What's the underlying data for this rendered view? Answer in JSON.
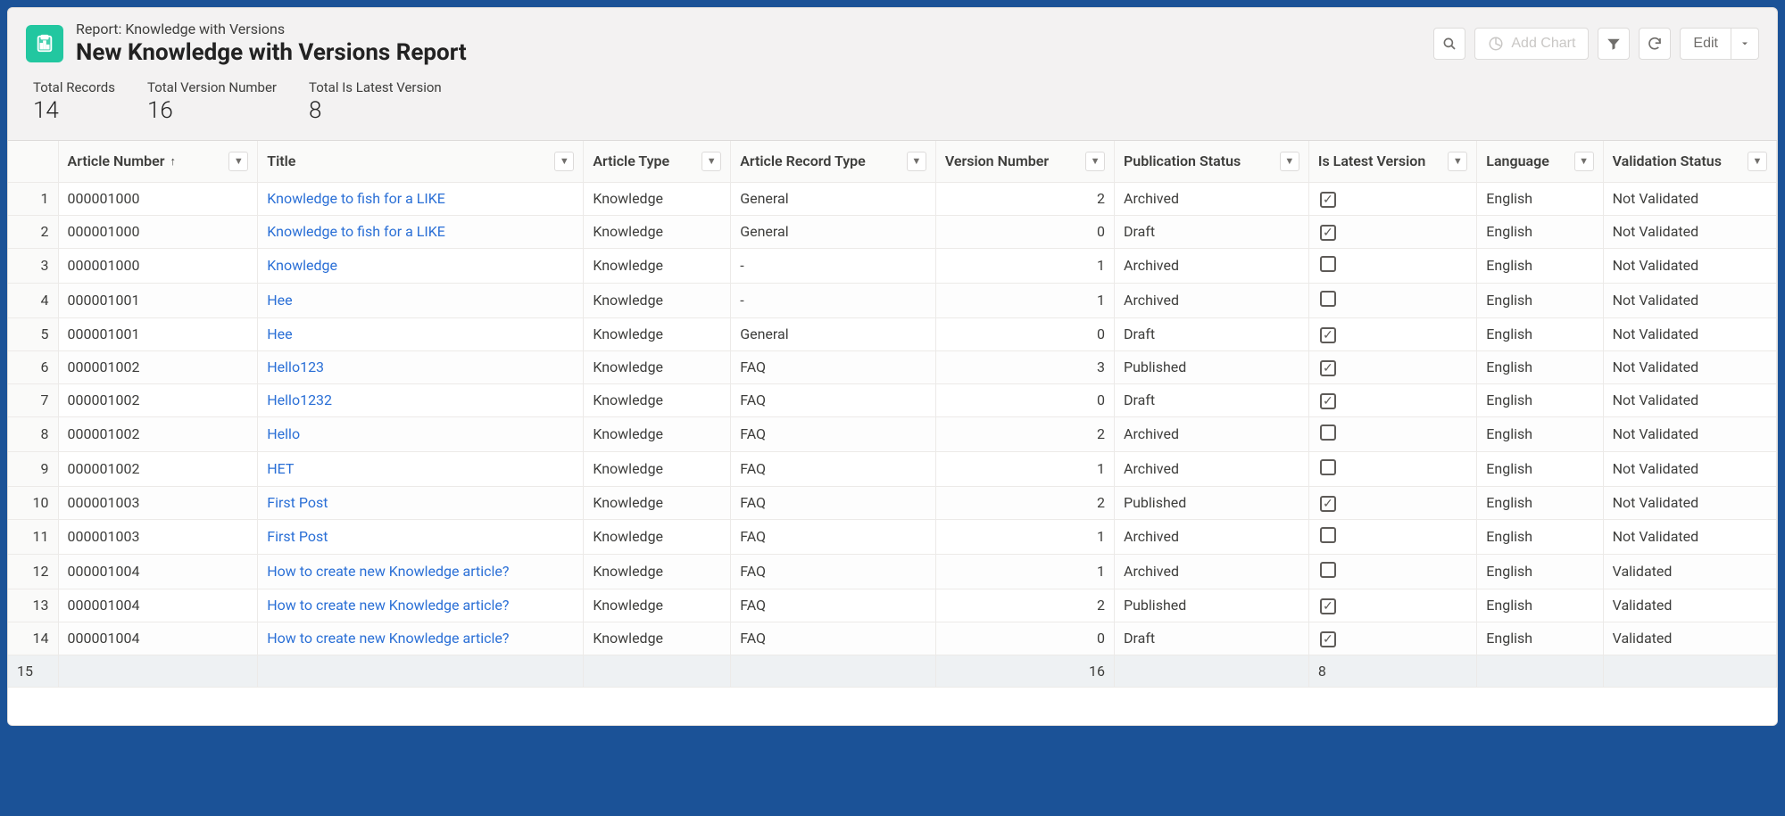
{
  "breadcrumb": "Report: Knowledge with Versions",
  "page_title": "New Knowledge with Versions Report",
  "actions": {
    "add_chart": "Add Chart",
    "edit": "Edit"
  },
  "summary": [
    {
      "label": "Total Records",
      "value": "14"
    },
    {
      "label": "Total Version Number",
      "value": "16"
    },
    {
      "label": "Total Is Latest Version",
      "value": "8"
    }
  ],
  "columns": [
    {
      "key": "article_number",
      "label": "Article Number",
      "sorted": true,
      "sort_dir": "asc"
    },
    {
      "key": "title",
      "label": "Title"
    },
    {
      "key": "article_type",
      "label": "Article Type"
    },
    {
      "key": "article_record_type",
      "label": "Article Record Type"
    },
    {
      "key": "version_number",
      "label": "Version Number",
      "align": "right"
    },
    {
      "key": "publication_status",
      "label": "Publication Status"
    },
    {
      "key": "is_latest_version",
      "label": "Is Latest Version"
    },
    {
      "key": "language",
      "label": "Language"
    },
    {
      "key": "validation_status",
      "label": "Validation Status"
    }
  ],
  "rows": [
    {
      "n": "1",
      "article_number": "000001000",
      "title": "Knowledge to fish for a LIKE",
      "article_type": "Knowledge",
      "article_record_type": "General",
      "version_number": "2",
      "publication_status": "Archived",
      "is_latest_version": true,
      "language": "English",
      "validation_status": "Not Validated"
    },
    {
      "n": "2",
      "article_number": "000001000",
      "title": "Knowledge to fish for a LIKE",
      "article_type": "Knowledge",
      "article_record_type": "General",
      "version_number": "0",
      "publication_status": "Draft",
      "is_latest_version": true,
      "language": "English",
      "validation_status": "Not Validated"
    },
    {
      "n": "3",
      "article_number": "000001000",
      "title": "Knowledge",
      "article_type": "Knowledge",
      "article_record_type": "-",
      "version_number": "1",
      "publication_status": "Archived",
      "is_latest_version": false,
      "language": "English",
      "validation_status": "Not Validated"
    },
    {
      "n": "4",
      "article_number": "000001001",
      "title": "Hee",
      "article_type": "Knowledge",
      "article_record_type": "-",
      "version_number": "1",
      "publication_status": "Archived",
      "is_latest_version": false,
      "language": "English",
      "validation_status": "Not Validated"
    },
    {
      "n": "5",
      "article_number": "000001001",
      "title": "Hee",
      "article_type": "Knowledge",
      "article_record_type": "General",
      "version_number": "0",
      "publication_status": "Draft",
      "is_latest_version": true,
      "language": "English",
      "validation_status": "Not Validated"
    },
    {
      "n": "6",
      "article_number": "000001002",
      "title": "Hello123",
      "article_type": "Knowledge",
      "article_record_type": "FAQ",
      "version_number": "3",
      "publication_status": "Published",
      "is_latest_version": true,
      "language": "English",
      "validation_status": "Not Validated"
    },
    {
      "n": "7",
      "article_number": "000001002",
      "title": "Hello1232",
      "article_type": "Knowledge",
      "article_record_type": "FAQ",
      "version_number": "0",
      "publication_status": "Draft",
      "is_latest_version": true,
      "language": "English",
      "validation_status": "Not Validated"
    },
    {
      "n": "8",
      "article_number": "000001002",
      "title": "Hello",
      "article_type": "Knowledge",
      "article_record_type": "FAQ",
      "version_number": "2",
      "publication_status": "Archived",
      "is_latest_version": false,
      "language": "English",
      "validation_status": "Not Validated"
    },
    {
      "n": "9",
      "article_number": "000001002",
      "title": "HET",
      "article_type": "Knowledge",
      "article_record_type": "FAQ",
      "version_number": "1",
      "publication_status": "Archived",
      "is_latest_version": false,
      "language": "English",
      "validation_status": "Not Validated"
    },
    {
      "n": "10",
      "article_number": "000001003",
      "title": "First Post",
      "article_type": "Knowledge",
      "article_record_type": "FAQ",
      "version_number": "2",
      "publication_status": "Published",
      "is_latest_version": true,
      "language": "English",
      "validation_status": "Not Validated"
    },
    {
      "n": "11",
      "article_number": "000001003",
      "title": "First Post",
      "article_type": "Knowledge",
      "article_record_type": "FAQ",
      "version_number": "1",
      "publication_status": "Archived",
      "is_latest_version": false,
      "language": "English",
      "validation_status": "Not Validated"
    },
    {
      "n": "12",
      "article_number": "000001004",
      "title": "How to create new Knowledge article?",
      "article_type": "Knowledge",
      "article_record_type": "FAQ",
      "version_number": "1",
      "publication_status": "Archived",
      "is_latest_version": false,
      "language": "English",
      "validation_status": "Validated"
    },
    {
      "n": "13",
      "article_number": "000001004",
      "title": "How to create new Knowledge article?",
      "article_type": "Knowledge",
      "article_record_type": "FAQ",
      "version_number": "2",
      "publication_status": "Published",
      "is_latest_version": true,
      "language": "English",
      "validation_status": "Validated"
    },
    {
      "n": "14",
      "article_number": "000001004",
      "title": "How to create new Knowledge article?",
      "article_type": "Knowledge",
      "article_record_type": "FAQ",
      "version_number": "0",
      "publication_status": "Draft",
      "is_latest_version": true,
      "language": "English",
      "validation_status": "Validated"
    }
  ],
  "totals": {
    "row_label": "15",
    "version_number": "16",
    "is_latest_version": "8"
  }
}
